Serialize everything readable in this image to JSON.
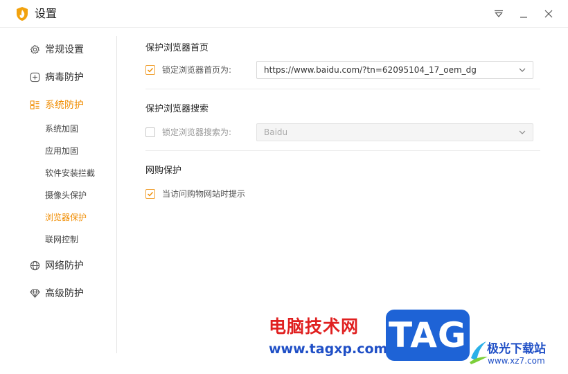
{
  "window": {
    "title": "设置",
    "accent_color": "#f08c00"
  },
  "sidebar": {
    "items": [
      {
        "label": "常规设置",
        "icon": "gear-icon"
      },
      {
        "label": "病毒防护",
        "icon": "plus-square-icon"
      },
      {
        "label": "系统防护",
        "icon": "system-grid-icon"
      },
      {
        "label": "网络防护",
        "icon": "globe-icon"
      },
      {
        "label": "高级防护",
        "icon": "diamond-icon"
      }
    ],
    "sub_items": [
      "系统加固",
      "应用加固",
      "软件安装拦截",
      "摄像头保护",
      "浏览器保护",
      "联网控制"
    ],
    "active_item": "系统防护",
    "active_sub_item": "浏览器保护"
  },
  "main": {
    "homepage": {
      "title": "保护浏览器首页",
      "checkbox_label": "锁定浏览器首页为:",
      "checked": true,
      "value": "https://www.baidu.com/?tn=62095104_17_oem_dg"
    },
    "search": {
      "title": "保护浏览器搜索",
      "checkbox_label": "锁定浏览器搜索为:",
      "checked": false,
      "value": "Baidu"
    },
    "shopping": {
      "title": "网购保护",
      "checkbox_label": "当访问购物网站时提示",
      "checked": true
    }
  },
  "watermark": {
    "cn_text": "电脑技术网",
    "url_text": "www.tagxp.com",
    "tag_text": "TAG",
    "site_cn": "极光下载站",
    "site_url": "www.xz7.com"
  }
}
